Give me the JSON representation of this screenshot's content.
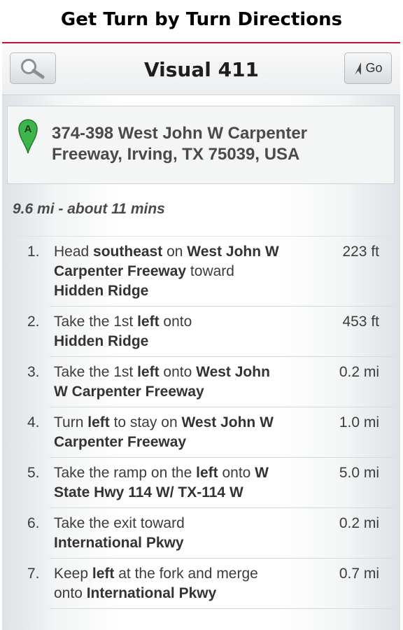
{
  "caption": "Get Turn by Turn Directions",
  "header": {
    "title": "Visual 411",
    "search_icon": "magnifier-icon",
    "go_label": "Go",
    "go_icon": "navigation-arrow-icon"
  },
  "destination": {
    "marker_letter": "A",
    "marker_icon": "map-pin-icon",
    "address": "374-398 West John W Carpenter Freeway, Irving, TX 75039, USA"
  },
  "summary": "9.6 mi - about 11 mins",
  "steps": [
    {
      "num": "1.",
      "dist": "223 ft",
      "parts": [
        {
          "t": "Head "
        },
        {
          "t": "southeast",
          "b": true
        },
        {
          "t": " on "
        },
        {
          "t": "West John W Carpenter Freeway",
          "b": true
        },
        {
          "t": " toward "
        },
        {
          "t": "Hidden Ridge",
          "b": true
        }
      ]
    },
    {
      "num": "2.",
      "dist": "453 ft",
      "parts": [
        {
          "t": "Take the 1st "
        },
        {
          "t": "left",
          "b": true
        },
        {
          "t": " onto "
        },
        {
          "t": "Hidden Ridge",
          "b": true,
          "br": true
        }
      ]
    },
    {
      "num": "3.",
      "dist": "0.2 mi",
      "parts": [
        {
          "t": "Take the 1st "
        },
        {
          "t": "left",
          "b": true
        },
        {
          "t": " onto "
        },
        {
          "t": "West John W Carpenter Freeway",
          "b": true
        }
      ]
    },
    {
      "num": "4.",
      "dist": "1.0 mi",
      "parts": [
        {
          "t": "Turn "
        },
        {
          "t": "left",
          "b": true
        },
        {
          "t": " to stay on "
        },
        {
          "t": "West John W Carpenter Freeway",
          "b": true
        }
      ]
    },
    {
      "num": "5.",
      "dist": "5.0 mi",
      "parts": [
        {
          "t": "Take the ramp on the "
        },
        {
          "t": "left",
          "b": true
        },
        {
          "t": " onto "
        },
        {
          "t": "W State Hwy 114 W/ TX-114 W",
          "b": true
        }
      ]
    },
    {
      "num": "6.",
      "dist": "0.2 mi",
      "parts": [
        {
          "t": "Take the exit toward "
        },
        {
          "t": "International Pkwy",
          "b": true,
          "br": true
        }
      ]
    },
    {
      "num": "7.",
      "dist": "0.7 mi",
      "parts": [
        {
          "t": "Keep "
        },
        {
          "t": "left",
          "b": true
        },
        {
          "t": " at the fork and merge onto "
        },
        {
          "t": "International Pkwy",
          "b": true
        }
      ]
    }
  ],
  "colors": {
    "accent_line": "#c8102e",
    "marker_green": "#3cb54a"
  }
}
